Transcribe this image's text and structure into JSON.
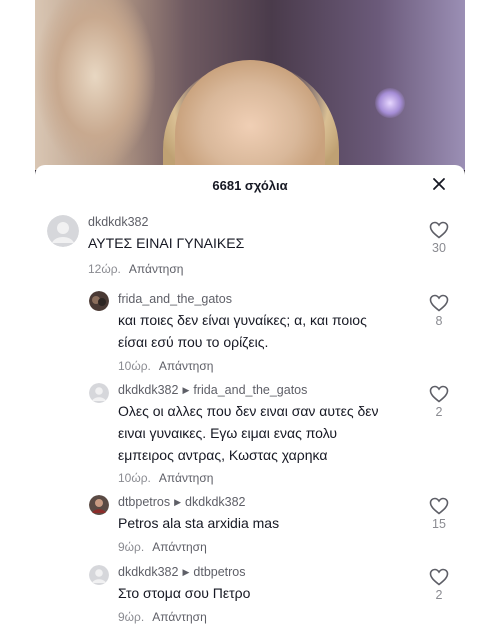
{
  "header": {
    "title": "6681 σχόλια"
  },
  "comments": [
    {
      "user": "dkdkdk382",
      "reply_to": "",
      "text_lines": [
        "ΑΥΤΕΣ ΕΙΝΑΙ ΓΥΝΑΙΚΕΣ"
      ],
      "time": "12ώρ.",
      "reply_label": "Απάντηση",
      "likes": "30",
      "avatar": "default"
    },
    {
      "user": "frida_and_the_gatos",
      "reply_to": "",
      "text_lines": [
        "και ποιες δεν είναι γυναίκες; α, και ποιος",
        "είσαι εσύ που το ορίζεις."
      ],
      "time": "10ώρ.",
      "reply_label": "Απάντηση",
      "likes": "8",
      "avatar": "photo"
    },
    {
      "user": "dkdkdk382",
      "reply_to": "frida_and_the_gatos",
      "text_lines": [
        "Ολες οι αλλες που δεν ειναι σαν αυτες δεν",
        "ειναι γυναικες. Εγω ειμαι ενας πολυ",
        "εμπειρος αντρας, Κωστας χαρηκα"
      ],
      "time": "10ώρ.",
      "reply_label": "Απάντηση",
      "likes": "2",
      "avatar": "default"
    },
    {
      "user": "dtbpetros",
      "reply_to": "dkdkdk382",
      "text_lines": [
        "Petros ala sta arxidia mas"
      ],
      "time": "9ώρ.",
      "reply_label": "Απάντηση",
      "likes": "15",
      "avatar": "photo"
    },
    {
      "user": "dkdkdk382",
      "reply_to": "dtbpetros",
      "text_lines": [
        "Στο στομα σου Πετρο"
      ],
      "time": "9ώρ.",
      "reply_label": "Απάντηση",
      "likes": "2",
      "avatar": "default"
    }
  ]
}
